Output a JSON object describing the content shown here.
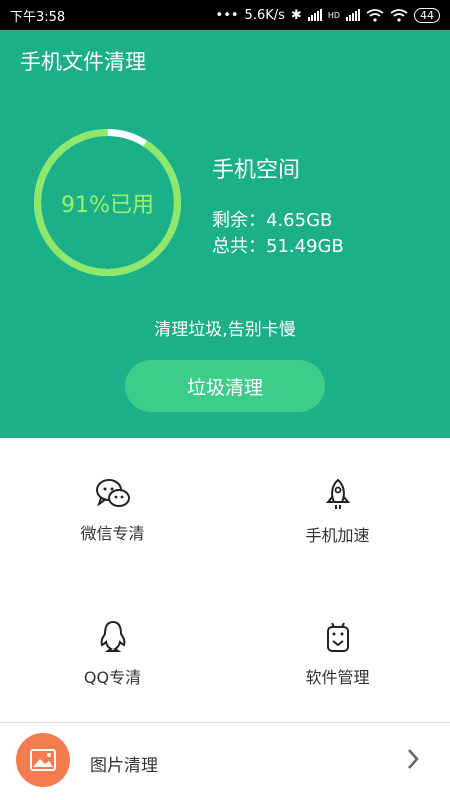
{
  "status_bar": {
    "time": "下午3:58",
    "net_speed": "5.6K/s",
    "hd": "HD",
    "battery": "44"
  },
  "header": {
    "title": "手机文件清理",
    "usage_label": "91%已用",
    "usage_fraction": 0.91,
    "storage_title": "手机空间",
    "remaining": "剩余：4.65GB",
    "total": "总共：51.49GB",
    "slogan": "清理垃圾,告别卡慢",
    "clean_button": "垃圾清理"
  },
  "features": [
    {
      "label": "微信专清",
      "icon": "wechat-icon"
    },
    {
      "label": "手机加速",
      "icon": "rocket-icon"
    },
    {
      "label": "QQ专清",
      "icon": "qq-icon"
    },
    {
      "label": "软件管理",
      "icon": "android-icon"
    }
  ],
  "photo_clean": {
    "label": "图片清理",
    "icon": "image-icon"
  },
  "colors": {
    "primary": "#1cb088",
    "button": "#3dcc8a",
    "ring": "#8ee86a",
    "accent": "#f47c4e"
  }
}
